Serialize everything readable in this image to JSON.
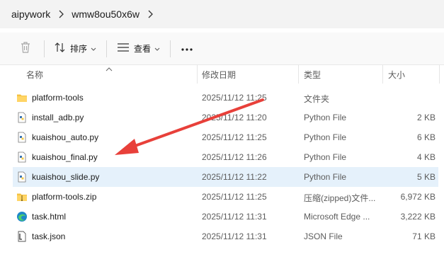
{
  "breadcrumb": {
    "items": [
      "aipywork",
      "wmw8ou50x6w"
    ]
  },
  "toolbar": {
    "sort_label": "排序",
    "view_label": "查看"
  },
  "columns": {
    "name": "名称",
    "date": "修改日期",
    "type": "类型",
    "size": "大小"
  },
  "files": [
    {
      "name": "platform-tools",
      "date": "2025/11/12 11:25",
      "type": "文件夹",
      "size": "",
      "icon": "folder-icon"
    },
    {
      "name": "install_adb.py",
      "date": "2025/11/12 11:20",
      "type": "Python File",
      "size": "2 KB",
      "icon": "python-file-icon"
    },
    {
      "name": "kuaishou_auto.py",
      "date": "2025/11/12 11:25",
      "type": "Python File",
      "size": "6 KB",
      "icon": "python-file-icon"
    },
    {
      "name": "kuaishou_final.py",
      "date": "2025/11/12 11:26",
      "type": "Python File",
      "size": "4 KB",
      "icon": "python-file-icon"
    },
    {
      "name": "kuaishou_slide.py",
      "date": "2025/11/12 11:22",
      "type": "Python File",
      "size": "5 KB",
      "icon": "python-file-icon",
      "selected": true
    },
    {
      "name": "platform-tools.zip",
      "date": "2025/11/12 11:25",
      "type": "压缩(zipped)文件...",
      "size": "6,972 KB",
      "icon": "zip-folder-icon"
    },
    {
      "name": "task.html",
      "date": "2025/11/12 11:31",
      "type": "Microsoft Edge ...",
      "size": "3,222 KB",
      "icon": "edge-html-icon"
    },
    {
      "name": "task.json",
      "date": "2025/11/12 11:31",
      "type": "JSON File",
      "size": "71 KB",
      "icon": "json-file-icon"
    }
  ],
  "colors": {
    "selection": "#e5f1fb",
    "arrow": "#e8403a",
    "folder": "#f5c242"
  }
}
